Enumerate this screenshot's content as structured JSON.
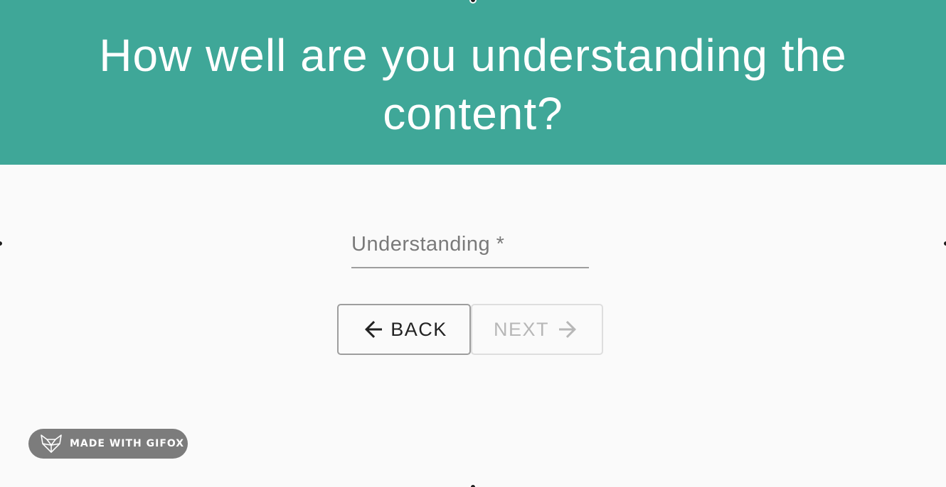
{
  "header": {
    "title": "How well are you understanding the content?",
    "background_color": "#3fa798"
  },
  "form": {
    "understanding_field": {
      "label": "Understanding *",
      "value": ""
    }
  },
  "navigation": {
    "back_label": "BACK",
    "back_icon": "arrow-left-icon",
    "next_label": "NEXT",
    "next_icon": "arrow-right-icon",
    "next_disabled": true
  },
  "watermark": {
    "label": "MADE WITH GIFOX",
    "icon": "fox-logo-icon"
  }
}
